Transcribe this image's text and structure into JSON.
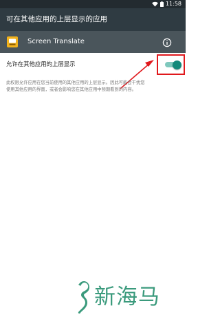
{
  "status_bar": {
    "time": "11:58"
  },
  "app_bar": {
    "title": "可在其他应用的上层显示的应用"
  },
  "app_row": {
    "name": "Screen Translate",
    "icon": "app-icon"
  },
  "setting": {
    "label": "允许在其他应用的上层显示",
    "enabled": true
  },
  "description": {
    "line1": "此权限允许应用在您当前使用的其他应用的上层显示。因此可能会干扰您",
    "line2": "使用其他应用的界面，或者会影响您在其他应用中预期看到的内容。"
  },
  "watermark": {
    "text": "新海马"
  },
  "colors": {
    "status_bar": "#232b30",
    "app_bar": "#2f3b42",
    "app_row": "#4a555b",
    "accent": "#12897a",
    "annotation": "#e0181c"
  }
}
